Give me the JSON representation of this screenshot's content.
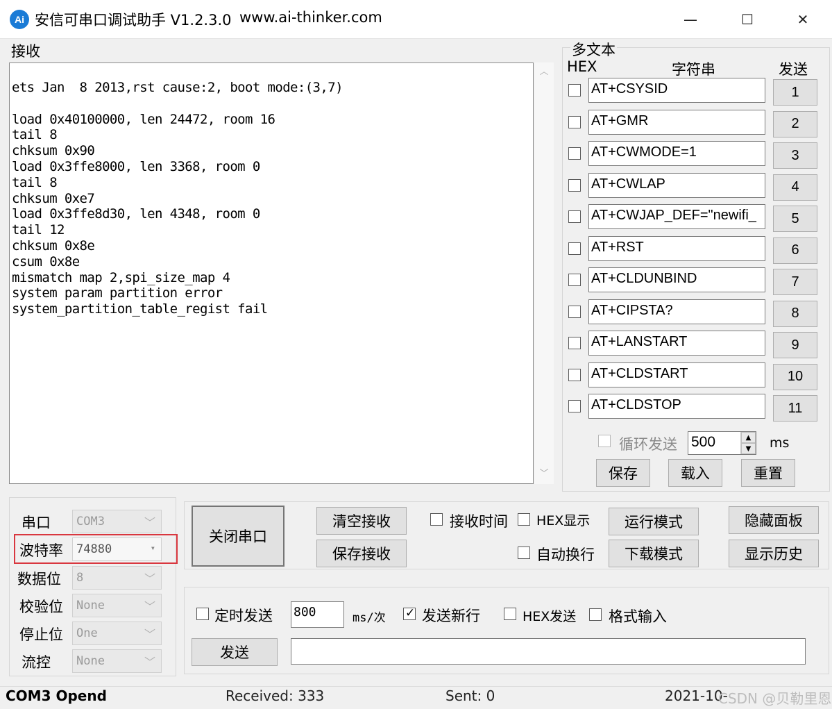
{
  "titlebar": {
    "icon": "Ai",
    "title": "安信可串口调试助手 V1.2.3.0",
    "url": "www.ai-thinker.com",
    "minimize": "—",
    "maximize": "☐",
    "close": "✕"
  },
  "receive": {
    "group_label": "接收",
    "text": "ets Jan  8 2013,rst cause:2, boot mode:(3,7)\n\nload 0x40100000, len 24472, room 16\ntail 8\nchksum 0x90\nload 0x3ffe8000, len 3368, room 0\ntail 8\nchksum 0xe7\nload 0x3ffe8d30, len 4348, room 0\ntail 12\nchksum 0x8e\ncsum 0x8e\nmismatch map 2,spi_size_map 4\nsystem param partition error\nsystem_partition_table_regist fail"
  },
  "multi": {
    "title": "多文本",
    "hdr_hex": "HEX",
    "hdr_string": "字符串",
    "hdr_send": "发送",
    "rows": [
      {
        "cmd": "AT+CSYSID",
        "btn": "1"
      },
      {
        "cmd": "AT+GMR",
        "btn": "2"
      },
      {
        "cmd": "AT+CWMODE=1",
        "btn": "3"
      },
      {
        "cmd": "AT+CWLAP",
        "btn": "4"
      },
      {
        "cmd": "AT+CWJAP_DEF=\"newifi_",
        "btn": "5"
      },
      {
        "cmd": "AT+RST",
        "btn": "6"
      },
      {
        "cmd": "AT+CLDUNBIND",
        "btn": "7"
      },
      {
        "cmd": "AT+CIPSTA?",
        "btn": "8"
      },
      {
        "cmd": "AT+LANSTART",
        "btn": "9"
      },
      {
        "cmd": "AT+CLDSTART",
        "btn": "10"
      },
      {
        "cmd": "AT+CLDSTOP",
        "btn": "11"
      }
    ],
    "loop_label": "循环发送",
    "loop_value": "500",
    "ms": "ms",
    "save": "保存",
    "load": "载入",
    "reset": "重置"
  },
  "port": {
    "port_label": "串口",
    "port_value": "COM3",
    "baud_label": "波特率",
    "baud_value": "74880",
    "databits_label": "数据位",
    "databits_value": "8",
    "parity_label": "校验位",
    "parity_value": "None",
    "stopbits_label": "停止位",
    "stopbits_value": "One",
    "flow_label": "流控",
    "flow_value": "None"
  },
  "controls": {
    "close_port": "关闭串口",
    "clear_recv": "清空接收",
    "save_recv": "保存接收",
    "recv_time": "接收时间",
    "hex_display": "HEX显示",
    "auto_wrap": "自动换行",
    "run_mode": "运行模式",
    "download_mode": "下载模式",
    "hide_panel": "隐藏面板",
    "show_history": "显示历史"
  },
  "send": {
    "timed_send": "定时发送",
    "period": "800",
    "period_unit": "ms/次",
    "send_newline": "发送新行",
    "newline_checked": true,
    "hex_send": "HEX发送",
    "format_input": "格式输入",
    "send_button": "发送",
    "send_text": ""
  },
  "status": {
    "port_state": "COM3 Opend",
    "received": "Received: 333",
    "sent": "Sent: 0",
    "datetime": "2021-10-",
    "watermark": "CSDN @贝勒里恩"
  }
}
